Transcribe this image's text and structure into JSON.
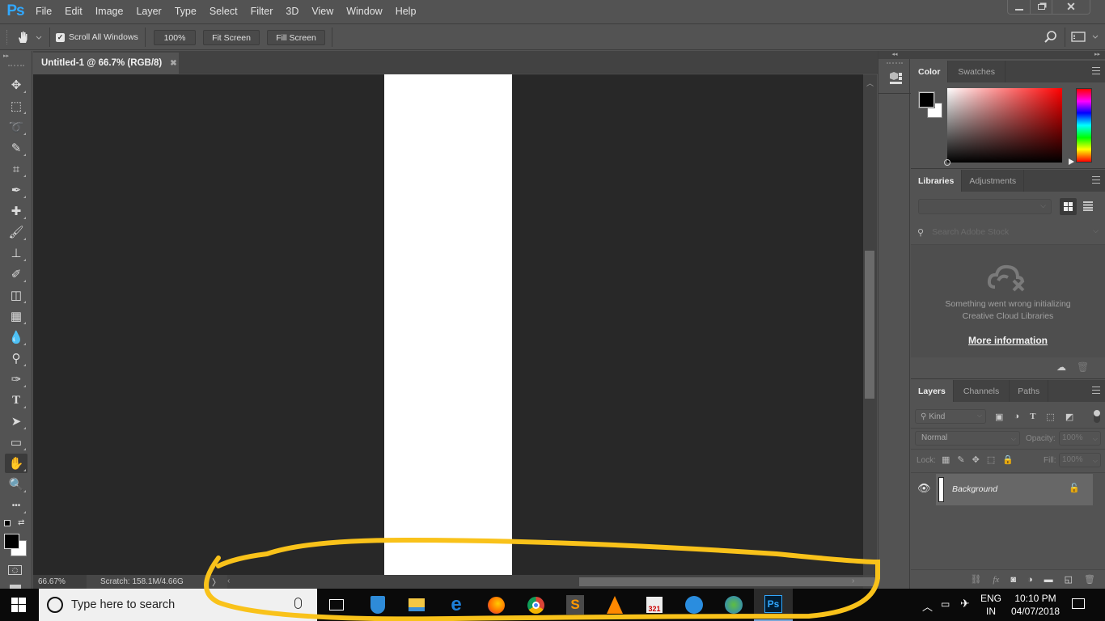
{
  "app": {
    "logo": "Ps",
    "menu": [
      "File",
      "Edit",
      "Image",
      "Layer",
      "Type",
      "Select",
      "Filter",
      "3D",
      "View",
      "Window",
      "Help"
    ],
    "window_controls": {
      "minimize": "minimize-icon",
      "restore": "restore-icon",
      "close": "close-icon"
    }
  },
  "options_bar": {
    "tool_icon": "hand-icon",
    "scroll_all_windows": {
      "label": "Scroll All Windows",
      "checked": true
    },
    "buttons": [
      "100%",
      "Fit Screen",
      "Fill Screen"
    ]
  },
  "document": {
    "tab_title": "Untitled-1 @ 66.7% (RGB/8)",
    "zoom": "66.67%",
    "scratch": "Scratch: 158.1M/4.66G",
    "horizontal_scroll_fraction": 0.5,
    "vertical_scroll_fraction": 0.65
  },
  "tools": [
    {
      "name": "move",
      "icon": "move-icon"
    },
    {
      "name": "marquee",
      "icon": "rectangular-marquee-icon"
    },
    {
      "name": "lasso",
      "icon": "lasso-icon"
    },
    {
      "name": "quick-selection",
      "icon": "quick-selection-icon"
    },
    {
      "name": "crop",
      "icon": "crop-icon"
    },
    {
      "name": "eyedropper",
      "icon": "eyedropper-icon"
    },
    {
      "name": "healing",
      "icon": "spot-healing-icon"
    },
    {
      "name": "brush",
      "icon": "brush-icon"
    },
    {
      "name": "stamp",
      "icon": "clone-stamp-icon"
    },
    {
      "name": "history-brush",
      "icon": "history-brush-icon"
    },
    {
      "name": "eraser",
      "icon": "eraser-icon"
    },
    {
      "name": "gradient",
      "icon": "gradient-icon"
    },
    {
      "name": "blur",
      "icon": "blur-icon"
    },
    {
      "name": "dodge",
      "icon": "dodge-icon"
    },
    {
      "name": "pen",
      "icon": "pen-icon"
    },
    {
      "name": "type",
      "icon": "type-icon"
    },
    {
      "name": "path-selection",
      "icon": "path-selection-icon"
    },
    {
      "name": "rectangle",
      "icon": "rectangle-shape-icon"
    },
    {
      "name": "hand",
      "icon": "hand-icon",
      "active": true
    },
    {
      "name": "zoom",
      "icon": "zoom-icon"
    },
    {
      "name": "more",
      "icon": "more-tools-icon"
    }
  ],
  "colors": {
    "foreground": "#000000",
    "background": "#ffffff",
    "accent": "#31a8ff",
    "highlight": "#f9c21a"
  },
  "panels": {
    "color": {
      "tabs": [
        "Color",
        "Swatches"
      ],
      "active": "Color"
    },
    "libraries": {
      "tabs": [
        "Libraries",
        "Adjustments"
      ],
      "active": "Libraries",
      "search_placeholder": "Search Adobe Stock",
      "error_line1": "Something went wrong initializing",
      "error_line2": "Creative Cloud Libraries",
      "more_info": "More information"
    },
    "layers": {
      "tabs": [
        "Layers",
        "Channels",
        "Paths"
      ],
      "active": "Layers",
      "filter_kind": "Kind",
      "blend_mode": "Normal",
      "opacity_label": "Opacity:",
      "opacity": "100%",
      "lock_label": "Lock:",
      "fill_label": "Fill:",
      "fill": "100%",
      "layers": [
        {
          "name": "Background",
          "visible": true,
          "locked": true
        }
      ]
    }
  },
  "taskbar": {
    "search_placeholder": "Type here to search",
    "apps": [
      "hotspot-shield-icon",
      "file-explorer-icon",
      "edge-icon",
      "firefox-icon",
      "chrome-icon",
      "sublime-text-icon",
      "vlc-icon",
      "media-player-classic-icon",
      "music-app-icon",
      "idm-icon",
      "photoshop-icon"
    ],
    "language_line1": "ENG",
    "language_line2": "IN",
    "time": "10:10 PM",
    "date": "04/07/2018"
  }
}
